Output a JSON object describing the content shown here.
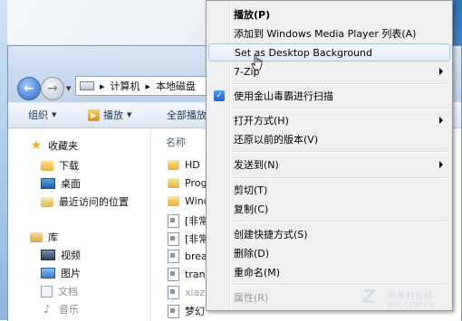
{
  "explorer": {
    "address": {
      "crumb1": "计算机",
      "crumb2": "本地磁盘"
    },
    "toolbar": {
      "organize": "组织",
      "play": "播放",
      "play_all": "全部播放"
    },
    "nav": {
      "favorites": "收藏夹",
      "downloads": "下载",
      "desktop": "桌面",
      "recent": "最近访问的位置",
      "libraries": "库",
      "videos": "视频",
      "pictures": "图片",
      "documents": "文档",
      "music": "音乐"
    },
    "files": {
      "column_name": "名称",
      "rows": [
        "HD",
        "Prog",
        "Wind",
        "[非常",
        "[非常",
        "brea",
        "trans",
        "xiazh",
        "梦幻"
      ]
    }
  },
  "context_menu": {
    "items": {
      "play": "播放(P)",
      "add_wmp": "添加到 Windows Media Player 列表(A)",
      "set_bg": "Set as Desktop Background",
      "zip": "7-Zip",
      "scan": "使用金山毒霸进行扫描",
      "open_with": "打开方式(H)",
      "restore": "还原以前的版本(V)",
      "send_to": "发送到(N)",
      "cut": "剪切(T)",
      "copy": "复制(C)",
      "shortcut": "创建快捷方式(S)",
      "delete": "删除(D)",
      "rename": "重命名(M)",
      "properties": "属性(R)"
    }
  },
  "watermark": {
    "logo": "Z",
    "cn": "中关村在线",
    "en": "ZOL.COM.CN"
  }
}
